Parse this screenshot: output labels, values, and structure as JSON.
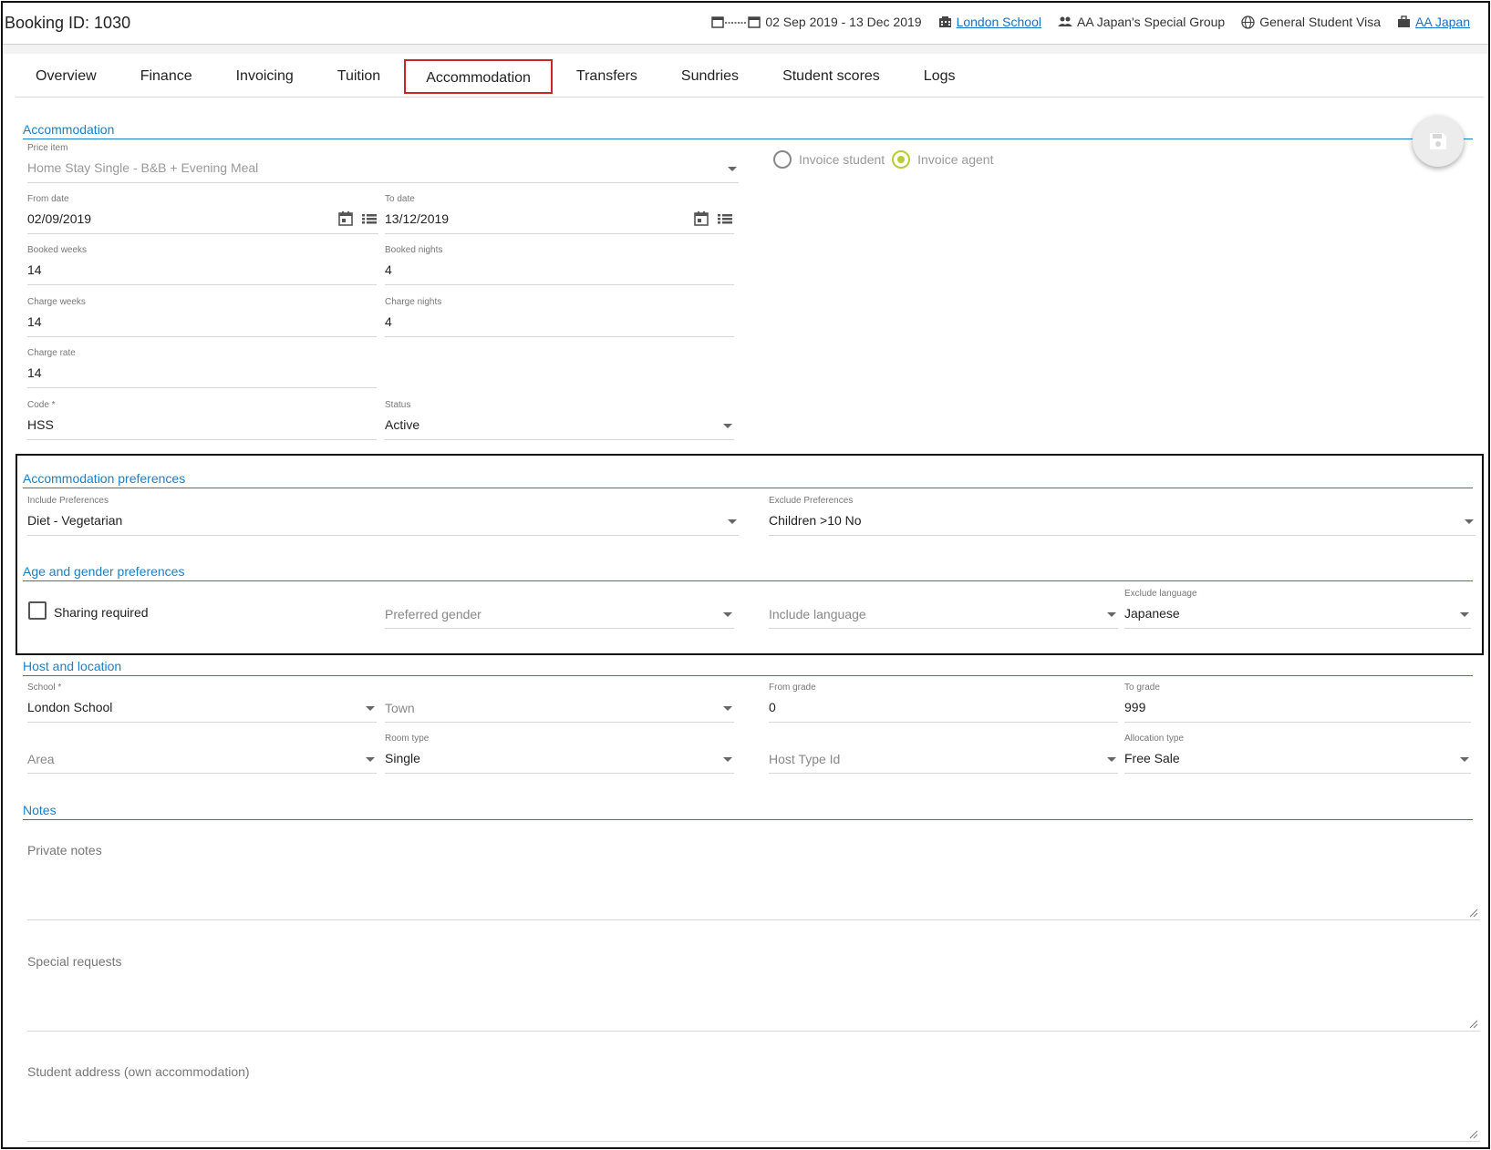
{
  "header": {
    "booking_id": "Booking ID: 1030",
    "dates": "02 Sep 2019 - 13 Dec 2019",
    "school": "London School",
    "group": "AA Japan's Special Group",
    "visa": "General Student Visa",
    "agent": "AA Japan"
  },
  "tabs": [
    {
      "label": "Overview"
    },
    {
      "label": "Finance"
    },
    {
      "label": "Invoicing"
    },
    {
      "label": "Tuition"
    },
    {
      "label": "Accommodation",
      "active": true
    },
    {
      "label": "Transfers"
    },
    {
      "label": "Sundries"
    },
    {
      "label": "Student scores"
    },
    {
      "label": "Logs"
    }
  ],
  "accommodation": {
    "title": "Accommodation",
    "price_item": {
      "label": "Price item",
      "value": "Home Stay Single - B&B + Evening Meal"
    },
    "invoice_student": "Invoice student",
    "invoice_agent": "Invoice agent",
    "from_date": {
      "label": "From date",
      "value": "02/09/2019"
    },
    "to_date": {
      "label": "To date",
      "value": "13/12/2019"
    },
    "booked_weeks": {
      "label": "Booked weeks",
      "value": "14"
    },
    "booked_nights": {
      "label": "Booked nights",
      "value": "4"
    },
    "charge_weeks": {
      "label": "Charge weeks",
      "value": "14"
    },
    "charge_nights": {
      "label": "Charge nights",
      "value": "4"
    },
    "charge_rate": {
      "label": "Charge rate",
      "value": "14"
    },
    "code": {
      "label": "Code *",
      "value": "HSS"
    },
    "status": {
      "label": "Status",
      "value": "Active"
    }
  },
  "accommodation_preferences": {
    "title": "Accommodation preferences",
    "include": {
      "label": "Include Preferences",
      "value": "Diet - Vegetarian"
    },
    "exclude": {
      "label": "Exclude Preferences",
      "value": "Children >10 No"
    }
  },
  "age_gender": {
    "title": "Age and gender preferences",
    "sharing_required": "Sharing required",
    "preferred_gender": "Preferred gender",
    "include_language": "Include language",
    "exclude_language": {
      "label": "Exclude language",
      "value": "Japanese"
    }
  },
  "host_location": {
    "title": "Host and location",
    "school": {
      "label": "School *",
      "value": "London School"
    },
    "town": "Town",
    "from_grade": {
      "label": "From grade",
      "value": "0"
    },
    "to_grade": {
      "label": "To grade",
      "value": "999"
    },
    "area": "Area",
    "room_type": {
      "label": "Room type",
      "value": "Single"
    },
    "host_type": "Host Type Id",
    "allocation_type": {
      "label": "Allocation type",
      "value": "Free Sale"
    }
  },
  "notes": {
    "title": "Notes",
    "private_notes": "Private notes",
    "special_requests": "Special requests",
    "student_address": "Student address (own accommodation)"
  },
  "colors": {
    "accent": "#1a80c8",
    "active_tab_border": "#c62828",
    "radio_on": "#b9cc33",
    "link": "#1a6fc4"
  },
  "icons": [
    "calendar-range-icon",
    "building-icon",
    "group-icon",
    "globe-icon",
    "briefcase-icon",
    "calendar-icon",
    "list-icon",
    "save-icon",
    "dropdown-caret-icon",
    "resize-handle-icon"
  ]
}
